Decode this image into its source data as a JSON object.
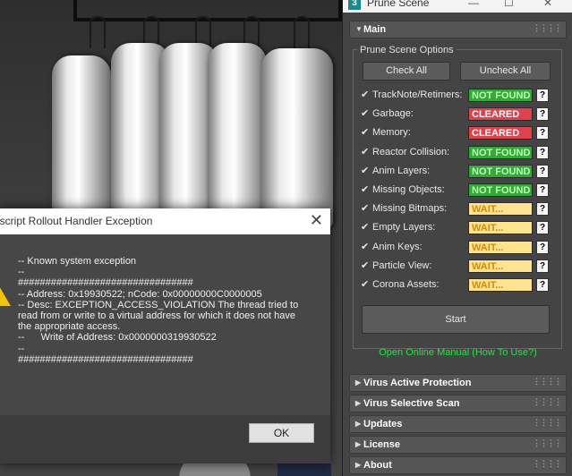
{
  "dialog": {
    "title": "Maxscript Rollout Handler Exception",
    "close_glyph": "✕",
    "message": "-- Known system exception\n--\n################################\n-- Address: 0x19930522; nCode: 0x00000000C0000005\n-- Desc: EXCEPTION_ACCESS_VIOLATION The thread tried to read from or write to a virtual address for which it does not have the appropriate access.\n--      Write of Address: 0x0000000319930522\n--\n################################",
    "ok_label": "OK"
  },
  "panel": {
    "title": "Prune Scene",
    "app_icon_glyph": "3",
    "window_controls": {
      "minimize": "—",
      "maximize": "☐",
      "close": "✕"
    },
    "main_rollout": {
      "title": "Main",
      "group_title": "Prune Scene Options",
      "check_all_label": "Check All",
      "uncheck_all_label": "Uncheck All",
      "start_label": "Start",
      "manual_link": "Open Online Manual (How To Use?)",
      "options": [
        {
          "label": "TrackNote/Retimers:",
          "status": "NOT FOUND",
          "status_kind": "notfound"
        },
        {
          "label": "Garbage:",
          "status": "CLEARED",
          "status_kind": "cleared"
        },
        {
          "label": "Memory:",
          "status": "CLEARED",
          "status_kind": "cleared"
        },
        {
          "label": "Reactor Collision:",
          "status": "NOT FOUND",
          "status_kind": "notfound"
        },
        {
          "label": "Anim Layers:",
          "status": "NOT FOUND",
          "status_kind": "notfound"
        },
        {
          "label": "Missing Objects:",
          "status": "NOT FOUND",
          "status_kind": "notfound"
        },
        {
          "label": "Missing Bitmaps:",
          "status": "WAIT...",
          "status_kind": "wait"
        },
        {
          "label": "Empty Layers:",
          "status": "WAIT...",
          "status_kind": "wait"
        },
        {
          "label": "Anim Keys:",
          "status": "WAIT...",
          "status_kind": "wait"
        },
        {
          "label": "Particle View:",
          "status": "WAIT...",
          "status_kind": "wait"
        },
        {
          "label": "Corona Assets:",
          "status": "WAIT...",
          "status_kind": "wait"
        }
      ],
      "checkbox_glyph": "✔",
      "help_glyph": "?"
    },
    "collapsed_rollouts": [
      "Virus Active Protection",
      "Virus Selective Scan",
      "Updates",
      "License",
      "About"
    ],
    "expanded_arrow": "▼",
    "collapsed_arrow": "▶",
    "grip_dots": "⋮⋮⋮⋮"
  },
  "colors": {
    "notfound_bg": "#35a83a",
    "notfound_fg": "#b6ffb0",
    "cleared_bg": "#e0414a",
    "cleared_fg": "#ffffff",
    "wait_bg": "#ffe38f",
    "wait_fg": "#d98b00",
    "link": "#26e24a"
  }
}
